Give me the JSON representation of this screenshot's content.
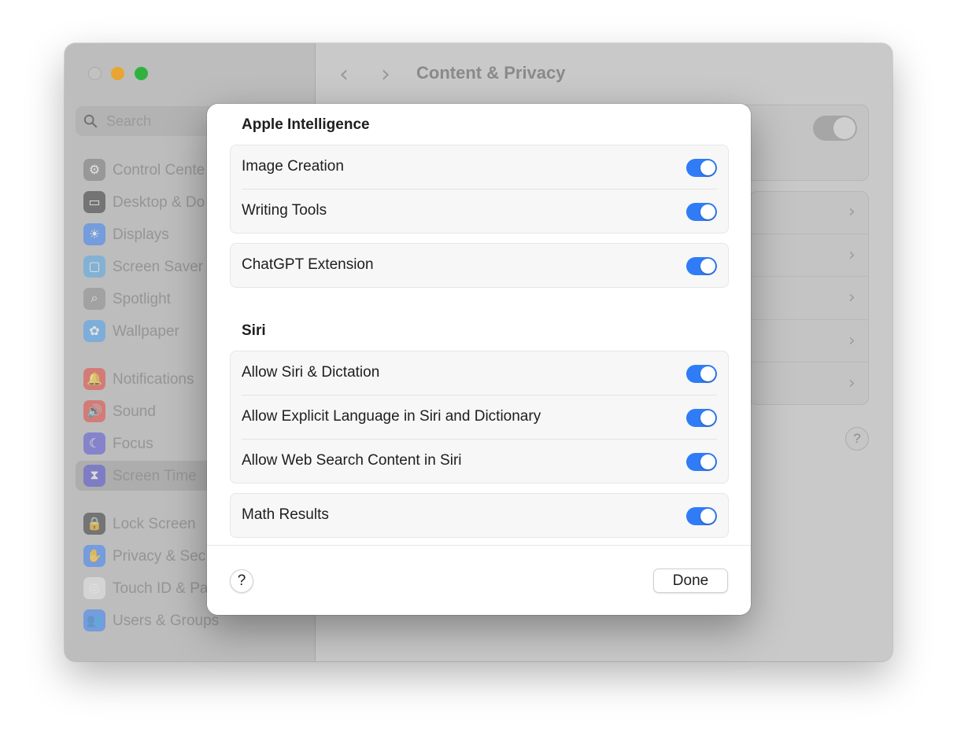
{
  "window": {
    "title": "Content & Privacy",
    "search_placeholder": "Search",
    "sidebar": [
      {
        "label": "Control Cente",
        "icon": "control-center-icon",
        "color": "#7a7a7a",
        "glyph": "⚙"
      },
      {
        "label": "Desktop & Do",
        "icon": "desktop-dock-icon",
        "color": "#3a3a3a",
        "glyph": "▭"
      },
      {
        "label": "Displays",
        "icon": "displays-icon",
        "color": "#3b82f6",
        "glyph": "☀"
      },
      {
        "label": "Screen Saver",
        "icon": "screen-saver-icon",
        "color": "#54a8e8",
        "glyph": "▢"
      },
      {
        "label": "Spotlight",
        "icon": "spotlight-icon",
        "color": "#8c8c8c",
        "glyph": "⌕"
      },
      {
        "label": "Wallpaper",
        "icon": "wallpaper-icon",
        "color": "#4aa3f0",
        "glyph": "✿"
      },
      {
        "label": "Notifications",
        "icon": "notifications-icon",
        "color": "#e5483f",
        "glyph": "🔔"
      },
      {
        "label": "Sound",
        "icon": "sound-icon",
        "color": "#e5483f",
        "glyph": "🔊"
      },
      {
        "label": "Focus",
        "icon": "focus-icon",
        "color": "#5856d6",
        "glyph": "☾"
      },
      {
        "label": "Screen Time",
        "icon": "screen-time-icon",
        "color": "#5856d6",
        "glyph": "⧗"
      },
      {
        "label": "Lock Screen",
        "icon": "lock-screen-icon",
        "color": "#3a3a3a",
        "glyph": "🔒"
      },
      {
        "label": "Privacy & Sec",
        "icon": "privacy-icon",
        "color": "#3b82f6",
        "glyph": "✋"
      },
      {
        "label": "Touch ID & Pa",
        "icon": "touch-id-icon",
        "color": "#e8e8e8",
        "glyph": "◎"
      },
      {
        "label": "Users & Groups",
        "icon": "users-groups-icon",
        "color": "#3b82f6",
        "glyph": "👥"
      }
    ]
  },
  "sheet": {
    "sections": [
      {
        "title": "Apple Intelligence",
        "groups": [
          [
            {
              "label": "Image Creation",
              "enabled": true
            },
            {
              "label": "Writing Tools",
              "enabled": true
            }
          ],
          [
            {
              "label": "ChatGPT Extension",
              "enabled": true
            }
          ]
        ]
      },
      {
        "title": "Siri",
        "groups": [
          [
            {
              "label": "Allow Siri & Dictation",
              "enabled": true
            },
            {
              "label": "Allow Explicit Language in Siri and Dictionary",
              "enabled": true
            },
            {
              "label": "Allow Web Search Content in Siri",
              "enabled": true
            }
          ],
          [
            {
              "label": "Math Results",
              "enabled": true
            }
          ]
        ]
      }
    ],
    "footer": {
      "help_label": "?",
      "done_label": "Done"
    }
  },
  "colors": {
    "accent": "#2f7cf6"
  }
}
